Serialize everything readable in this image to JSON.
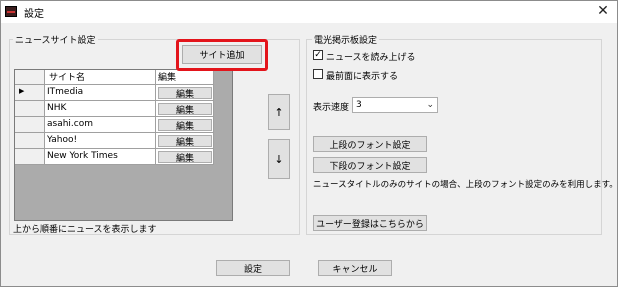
{
  "window": {
    "title": "設定",
    "close_symbol": "✕"
  },
  "news_site_group": {
    "legend": "ニュースサイト設定",
    "add_site_label": "サイト追加",
    "columns": [
      "サイト名",
      "編集"
    ],
    "current_row_marker": "▶",
    "rows": [
      {
        "name": "ITmedia",
        "edit_label": "編集"
      },
      {
        "name": "NHK",
        "edit_label": "編集"
      },
      {
        "name": "asahi.com",
        "edit_label": "編集"
      },
      {
        "name": "Yahoo!",
        "edit_label": "編集"
      },
      {
        "name": "New York Times",
        "edit_label": "編集"
      }
    ],
    "up_label": "↑",
    "down_label": "↓",
    "footer_note": "上から順番にニュースを表示します"
  },
  "board_group": {
    "legend": "電光掲示板設定",
    "read_aloud": {
      "label": "ニュースを読み上げる",
      "checked": true,
      "check_mark": "✓"
    },
    "always_on_top": {
      "label": "最前面に表示する",
      "checked": false
    },
    "speed_label": "表示速度",
    "speed_value": "3",
    "upper_font_label": "上段のフォント設定",
    "lower_font_label": "下段のフォント設定",
    "font_note": "ニュースタイトルのみのサイトの場合、上段のフォント設定のみを利用します。",
    "user_register_label": "ユーザー登録はこちらから"
  },
  "footer": {
    "ok_label": "設定",
    "cancel_label": "キャンセル"
  },
  "colors": {
    "highlight": "#e3141b",
    "grid_bg": "#ababab"
  }
}
